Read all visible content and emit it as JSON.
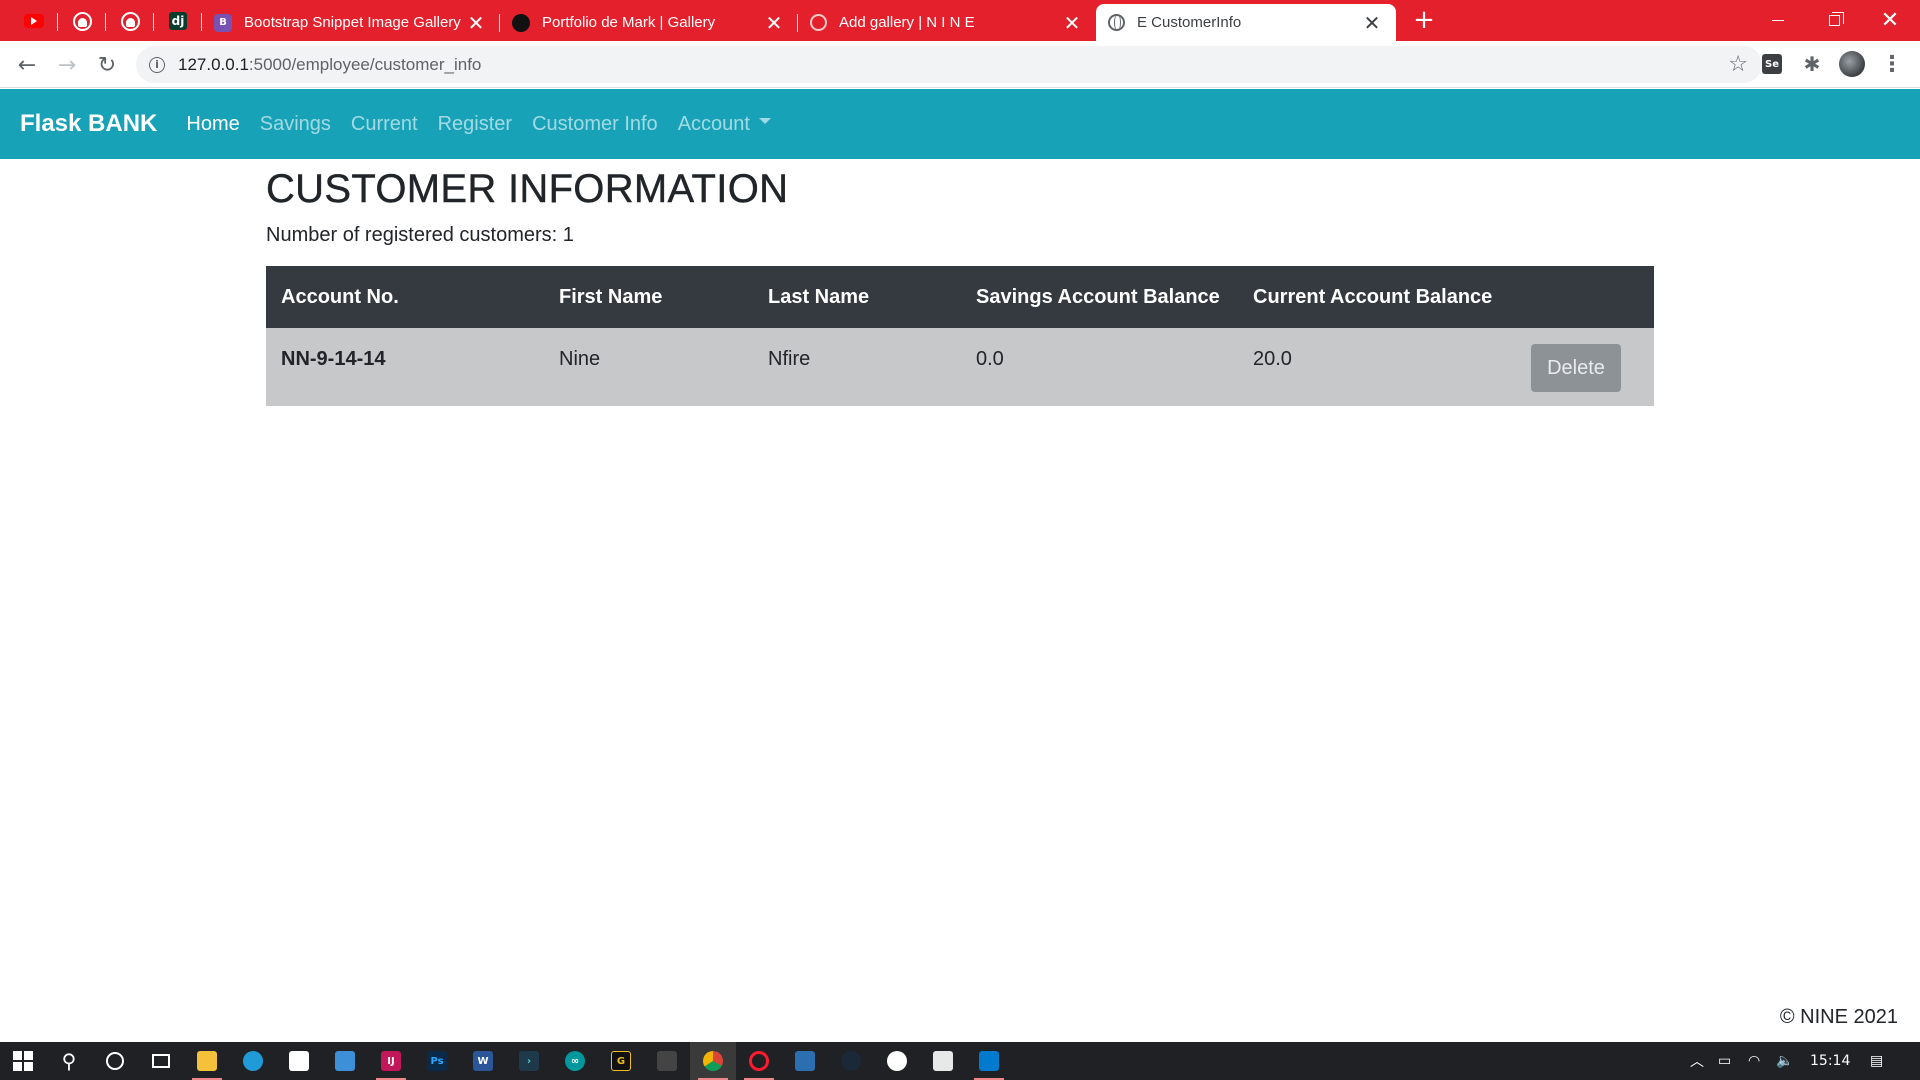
{
  "browser": {
    "pinned_tabs": [
      {
        "name": "youtube"
      },
      {
        "name": "github"
      },
      {
        "name": "github"
      },
      {
        "name": "django",
        "label": "dj"
      }
    ],
    "tabs": [
      {
        "title": "Bootstrap Snippet Image Gallery",
        "favicon": "bootstrap-icon"
      },
      {
        "title": "Portfolio de Mark | Gallery",
        "favicon": "portfolio-icon"
      },
      {
        "title": "Add gallery | N I N E",
        "favicon": "globe-icon"
      },
      {
        "title": "E CustomerInfo",
        "favicon": "globe-icon",
        "active": true
      }
    ],
    "new_tab_glyph": "+",
    "close_glyph": "✕",
    "url_host": "127.0.0.1",
    "url_path": ":5000/employee/customer_info",
    "extension_label": "Se",
    "tab_strip_color": "#e3202c"
  },
  "navbar": {
    "brand": "Flask BANK",
    "links": [
      "Home",
      "Savings",
      "Current",
      "Register",
      "Customer Info",
      "Account"
    ],
    "active": "Home",
    "color": "#17a2b8"
  },
  "page": {
    "title": "CUSTOMER INFORMATION",
    "count_label": "Number of registered customers: 1",
    "table": {
      "headers": [
        "Account No.",
        "First Name",
        "Last Name",
        "Savings Account Balance",
        "Current Account Balance"
      ],
      "rows": [
        {
          "account_no": "NN-9-14-14",
          "first_name": "Nine",
          "last_name": "Nfire",
          "savings_balance": "0.0",
          "current_balance": "20.0",
          "action": "Delete"
        }
      ]
    },
    "footer": "© NINE 2021"
  },
  "taskbar": {
    "time": "15:14"
  }
}
